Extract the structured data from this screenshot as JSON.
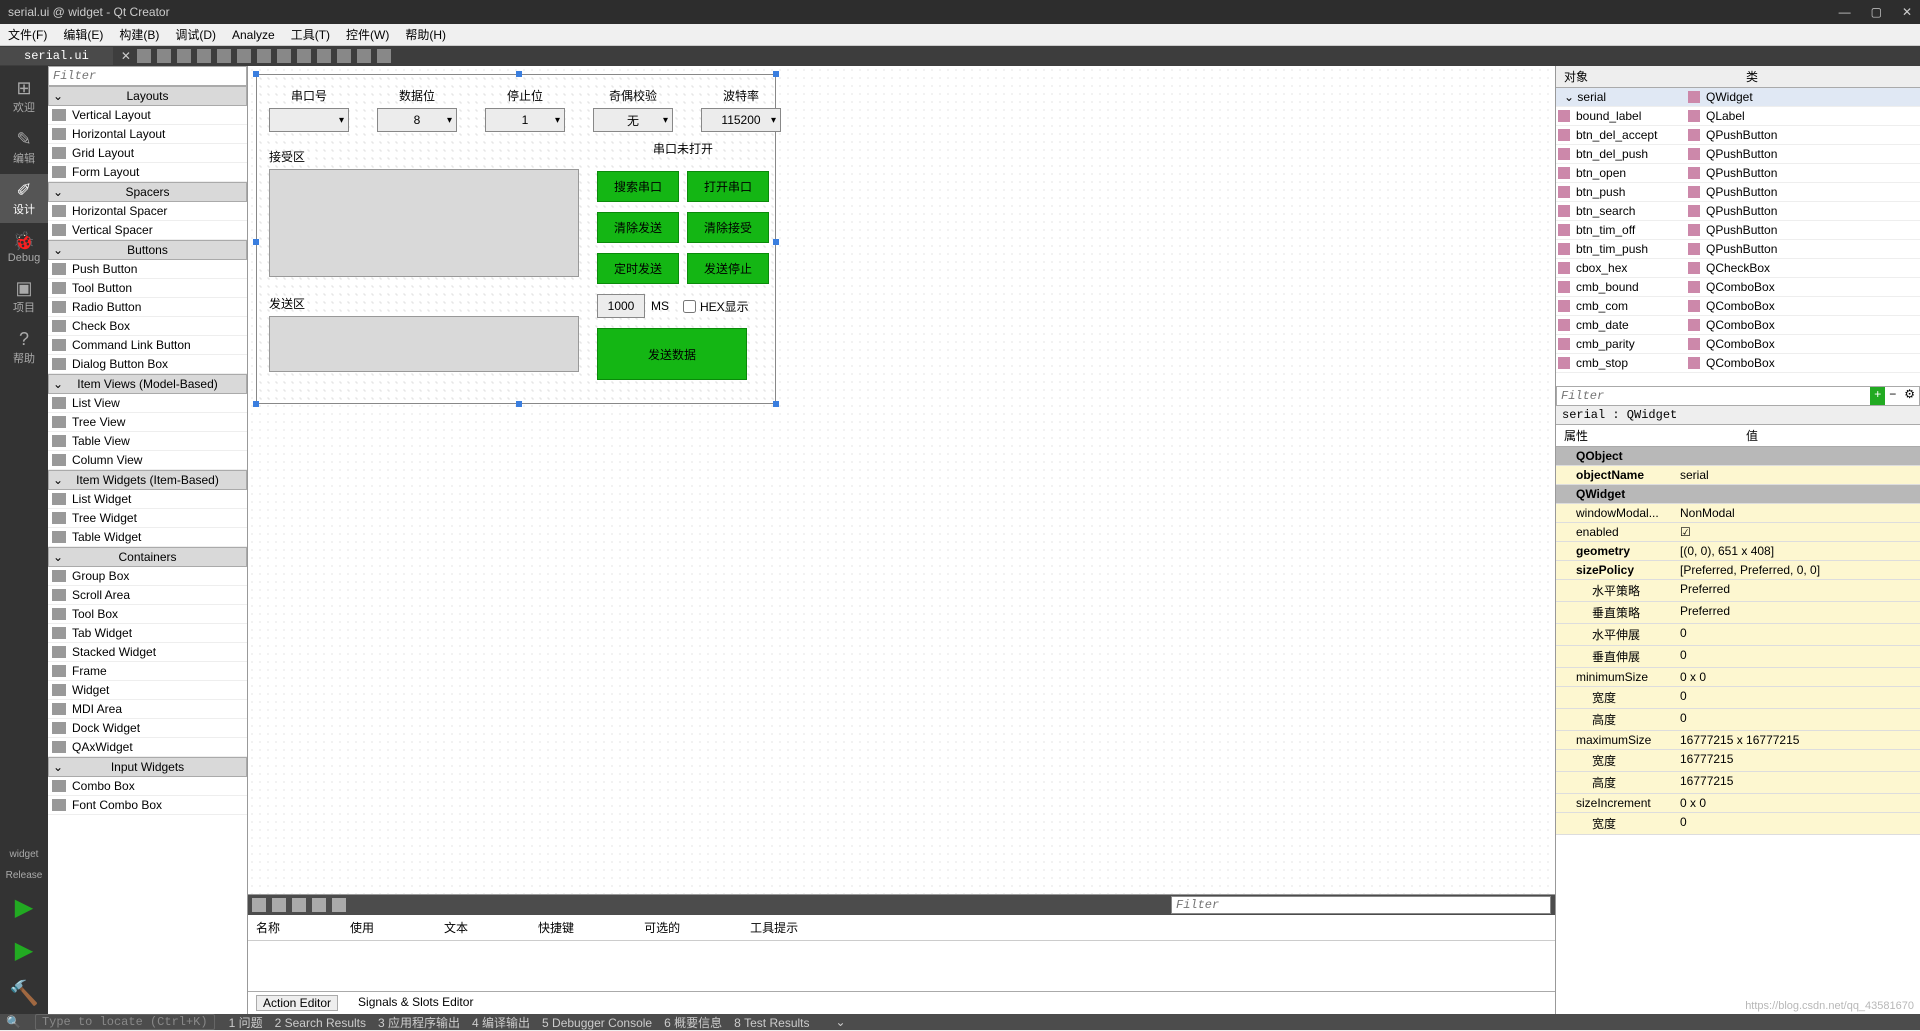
{
  "window": {
    "title": "serial.ui @ widget - Qt Creator"
  },
  "menu": [
    "文件(F)",
    "编辑(E)",
    "构建(B)",
    "调试(D)",
    "Analyze",
    "工具(T)",
    "控件(W)",
    "帮助(H)"
  ],
  "openTab": "serial.ui",
  "leftModes": [
    {
      "icon": "⊞",
      "label": "欢迎"
    },
    {
      "icon": "✎",
      "label": "编辑"
    },
    {
      "icon": "✐",
      "label": "设计"
    },
    {
      "icon": "🐞",
      "label": "Debug"
    },
    {
      "icon": "▣",
      "label": "项目"
    },
    {
      "icon": "?",
      "label": "帮助"
    }
  ],
  "buildLabels": [
    "widget",
    "Release"
  ],
  "widgetBox": {
    "filterPlaceholder": "Filter",
    "categories": [
      {
        "name": "Layouts",
        "items": [
          "Vertical Layout",
          "Horizontal Layout",
          "Grid Layout",
          "Form Layout"
        ]
      },
      {
        "name": "Spacers",
        "items": [
          "Horizontal Spacer",
          "Vertical Spacer"
        ]
      },
      {
        "name": "Buttons",
        "items": [
          "Push Button",
          "Tool Button",
          "Radio Button",
          "Check Box",
          "Command Link Button",
          "Dialog Button Box"
        ]
      },
      {
        "name": "Item Views (Model-Based)",
        "items": [
          "List View",
          "Tree View",
          "Table View",
          "Column View"
        ]
      },
      {
        "name": "Item Widgets (Item-Based)",
        "items": [
          "List Widget",
          "Tree Widget",
          "Table Widget"
        ]
      },
      {
        "name": "Containers",
        "items": [
          "Group Box",
          "Scroll Area",
          "Tool Box",
          "Tab Widget",
          "Stacked Widget",
          "Frame",
          "Widget",
          "MDI Area",
          "Dock Widget",
          "QAxWidget"
        ]
      },
      {
        "name": "Input Widgets",
        "items": [
          "Combo Box",
          "Font Combo Box"
        ]
      }
    ]
  },
  "form": {
    "headerLabels": [
      "串口号",
      "数据位",
      "停止位",
      "奇偶校验",
      "波特率"
    ],
    "comboValues": [
      "",
      "8",
      "1",
      "无",
      "115200"
    ],
    "recvLabel": "接受区",
    "sendLabel": "发送区",
    "statusLabel": "串口未打开",
    "buttons": {
      "search": "搜索串口",
      "open": "打开串口",
      "clearSend": "清除发送",
      "clearRecv": "清除接受",
      "timedSend": "定时发送",
      "stopSend": "发送停止",
      "sendData": "发送数据"
    },
    "msValue": "1000",
    "msLabel": "MS",
    "hexLabel": "HEX显示"
  },
  "actionEditor": {
    "filterPlaceholder": "Filter",
    "headers": [
      "名称",
      "使用",
      "文本",
      "快捷键",
      "可选的",
      "工具提示"
    ],
    "tabs": [
      "Action Editor",
      "Signals & Slots Editor"
    ]
  },
  "objectInspector": {
    "headers": [
      "对象",
      "类"
    ],
    "rows": [
      {
        "name": "serial",
        "class": "QWidget",
        "root": true
      },
      {
        "name": "bound_label",
        "class": "QLabel"
      },
      {
        "name": "btn_del_accept",
        "class": "QPushButton"
      },
      {
        "name": "btn_del_push",
        "class": "QPushButton"
      },
      {
        "name": "btn_open",
        "class": "QPushButton"
      },
      {
        "name": "btn_push",
        "class": "QPushButton"
      },
      {
        "name": "btn_search",
        "class": "QPushButton"
      },
      {
        "name": "btn_tim_off",
        "class": "QPushButton"
      },
      {
        "name": "btn_tim_push",
        "class": "QPushButton"
      },
      {
        "name": "cbox_hex",
        "class": "QCheckBox"
      },
      {
        "name": "cmb_bound",
        "class": "QComboBox"
      },
      {
        "name": "cmb_com",
        "class": "QComboBox"
      },
      {
        "name": "cmb_date",
        "class": "QComboBox"
      },
      {
        "name": "cmb_parity",
        "class": "QComboBox"
      },
      {
        "name": "cmb_stop",
        "class": "QComboBox"
      }
    ]
  },
  "propertyEditor": {
    "filterPlaceholder": "Filter",
    "path": "serial : QWidget",
    "headers": [
      "属性",
      "值"
    ],
    "rows": [
      {
        "name": "QObject",
        "group": true
      },
      {
        "name": "objectName",
        "value": "serial",
        "yellow": true,
        "bold": true
      },
      {
        "name": "QWidget",
        "group": true
      },
      {
        "name": "windowModal...",
        "value": "NonModal",
        "yellow": true
      },
      {
        "name": "enabled",
        "value": "☑",
        "yellow": true
      },
      {
        "name": "geometry",
        "value": "[(0, 0), 651 x 408]",
        "yellow": true,
        "bold": true
      },
      {
        "name": "sizePolicy",
        "value": "[Preferred, Preferred, 0, 0]",
        "yellow": true,
        "bold": true
      },
      {
        "name": "水平策略",
        "value": "Preferred",
        "yellow": true,
        "sub": true
      },
      {
        "name": "垂直策略",
        "value": "Preferred",
        "yellow": true,
        "sub": true
      },
      {
        "name": "水平伸展",
        "value": "0",
        "yellow": true,
        "sub": true
      },
      {
        "name": "垂直伸展",
        "value": "0",
        "yellow": true,
        "sub": true
      },
      {
        "name": "minimumSize",
        "value": "0 x 0",
        "yellow": true
      },
      {
        "name": "宽度",
        "value": "0",
        "yellow": true,
        "sub": true
      },
      {
        "name": "高度",
        "value": "0",
        "yellow": true,
        "sub": true
      },
      {
        "name": "maximumSize",
        "value": "16777215 x 16777215",
        "yellow": true
      },
      {
        "name": "宽度",
        "value": "16777215",
        "yellow": true,
        "sub": true
      },
      {
        "name": "高度",
        "value": "16777215",
        "yellow": true,
        "sub": true
      },
      {
        "name": "sizeIncrement",
        "value": "0 x 0",
        "yellow": true
      },
      {
        "name": "宽度",
        "value": "0",
        "yellow": true,
        "sub": true
      }
    ]
  },
  "statusbar": {
    "locate": "Type to locate (Ctrl+K)",
    "items": [
      "1 问题",
      "2 Search Results",
      "3 应用程序输出",
      "4 编译输出",
      "5 Debugger Console",
      "6 概要信息",
      "8 Test Results"
    ]
  },
  "watermark": "https://blog.csdn.net/qq_43581670"
}
